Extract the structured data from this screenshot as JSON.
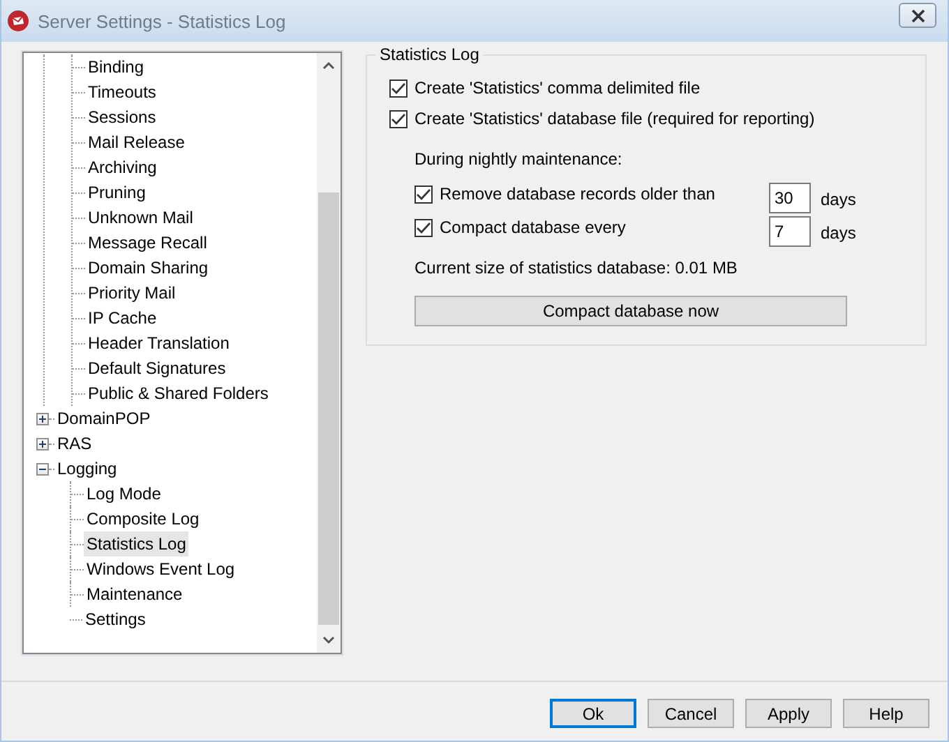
{
  "window": {
    "title": "Server Settings - Statistics Log"
  },
  "tree": {
    "continued_children": [
      {
        "label": "Binding",
        "selected": false
      },
      {
        "label": "Timeouts",
        "selected": false
      },
      {
        "label": "Sessions",
        "selected": false
      },
      {
        "label": "Mail Release",
        "selected": false
      },
      {
        "label": "Archiving",
        "selected": false
      },
      {
        "label": "Pruning",
        "selected": false
      },
      {
        "label": "Unknown Mail",
        "selected": false
      },
      {
        "label": "Message Recall",
        "selected": false
      },
      {
        "label": "Domain Sharing",
        "selected": false
      },
      {
        "label": "Priority Mail",
        "selected": false
      },
      {
        "label": "IP Cache",
        "selected": false
      },
      {
        "label": "Header Translation",
        "selected": false
      },
      {
        "label": "Default Signatures",
        "selected": false
      },
      {
        "label": "Public & Shared Folders",
        "selected": false
      }
    ],
    "items": [
      {
        "label": "DomainPOP",
        "expanded": false,
        "selected": false
      },
      {
        "label": "RAS",
        "expanded": false,
        "selected": false
      },
      {
        "label": "Logging",
        "expanded": true,
        "selected": false,
        "children": [
          {
            "label": "Log Mode",
            "selected": false
          },
          {
            "label": "Composite Log",
            "selected": false
          },
          {
            "label": "Statistics Log",
            "selected": true
          },
          {
            "label": "Windows Event Log",
            "selected": false
          },
          {
            "label": "Maintenance",
            "selected": false
          },
          {
            "label": "Settings",
            "selected": false
          }
        ]
      }
    ]
  },
  "group": {
    "title": "Statistics Log",
    "options": [
      {
        "label": "Create 'Statistics' comma delimited file",
        "checked": true
      },
      {
        "label": "Create 'Statistics' database file (required for reporting)",
        "checked": true
      }
    ],
    "maintenance_label": "During nightly maintenance:",
    "maintenance_options": [
      {
        "label": "Remove database records older than",
        "checked": true,
        "value": "30",
        "unit": "days"
      },
      {
        "label": "Compact database every",
        "checked": true,
        "value": "7",
        "unit": "days"
      }
    ],
    "size_text": "Current size of statistics database: 0.01 MB",
    "compact_button": "Compact database now"
  },
  "buttons": [
    {
      "label": "Ok",
      "focused": true
    },
    {
      "label": "Cancel",
      "focused": false
    },
    {
      "label": "Apply",
      "focused": false
    },
    {
      "label": "Help",
      "focused": false
    }
  ]
}
